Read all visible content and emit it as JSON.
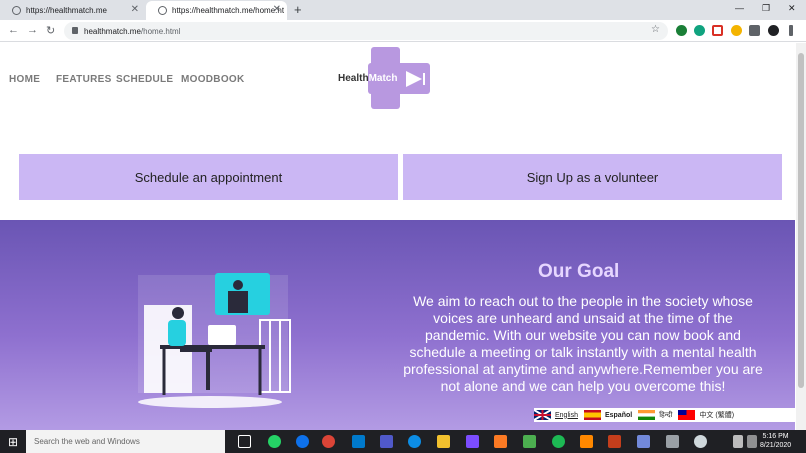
{
  "browser": {
    "tabs": [
      {
        "title": "https://healthmatch.me"
      },
      {
        "title": "https://healthmatch.me/home.ht"
      }
    ],
    "url_host": "healthmatch.me",
    "url_path": "/home.html"
  },
  "site": {
    "nav": [
      "HOME",
      "FEATURES",
      "SCHEDULE",
      "MOODBOOK"
    ],
    "logo_text_a": "Health",
    "logo_text_b": "Match",
    "cta_schedule": "Schedule an appointment",
    "cta_volunteer": "Sign Up as a volunteer",
    "goal_title": "Our Goal",
    "goal_text": "We aim to reach out to the people in the society whose voices are unheard and unsaid at the time of the pandemic. With our website you can now book and schedule a meeting or talk instantly with a mental health professional at anytime and anywhere.Remember you are not alone and we can help you overcome this!",
    "languages": [
      "English",
      "Español",
      "हिन्दी",
      "中文 (繁體)"
    ]
  },
  "taskbar": {
    "search_placeholder": "Search the web and Windows",
    "time": "5:16 PM",
    "date": "8/21/2020"
  },
  "colors": {
    "lavender": "#cbb7f4",
    "hero_top": "#6a55b4",
    "hero_bottom": "#b39be4",
    "logo": "#b898e0"
  }
}
